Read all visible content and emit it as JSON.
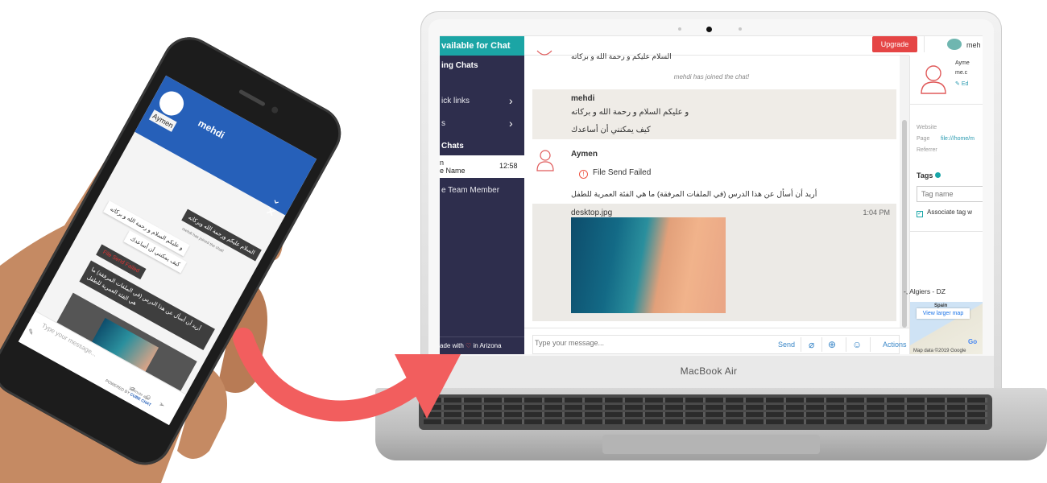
{
  "laptop": {
    "brand": "MacBook Air",
    "app": {
      "sidebar": {
        "status_label": "vailable for Chat",
        "ongoing_label": "ing Chats",
        "quick_links_label": "ick links",
        "item_two_label": "s",
        "chats_heading": "Chats",
        "active_chat": {
          "name": "n",
          "subtitle": "e Name",
          "time": "12:58"
        },
        "team_member_label": "e Team Member",
        "footer_prefix": "ade with",
        "footer_suffix": "in Arizona"
      },
      "conversation": {
        "top_partial_text": "السلام عليكم و رحمة الله و بركاته",
        "system_note": "mehdi has joined the chat!",
        "agent_message": {
          "sender": "mehdi",
          "line1": "و عليكم السلام و رحمة الله و بركاته",
          "line2": "كيف يمكنني أن أساعدك"
        },
        "visitor_message": {
          "sender": "Aymen",
          "failed_text": "File Send Failed",
          "text": "أريد أن أسأل عن هذا الدرس (في الملفات المرفقة) ما هي الفئة العمرية للطفل"
        },
        "attachment": {
          "file_name": "desktop.jpg",
          "time": "1:04 PM"
        }
      },
      "composer": {
        "placeholder": "Type your message...",
        "send_label": "Send",
        "actions_label": "Actions"
      },
      "right_panel": {
        "upgrade_label": "Upgrade",
        "agent_name": "meh",
        "visitor_name": "Ayme",
        "visitor_email": "me.c",
        "edit_label": "Ed",
        "website_label": "Website",
        "page_label": "Page",
        "page_value": "file:///home/m",
        "referrer_label": "Referrer",
        "tags_heading": "Tags",
        "tag_placeholder": "Tag name",
        "associate_label": "Associate tag w",
        "location": "-, Algiers - DZ",
        "map_button": "View larger map",
        "map_label": "Spain",
        "map_credit": "Map data ©2019 Google",
        "map_logo": "Go"
      }
    }
  },
  "phone": {
    "agent_name": "mehdi",
    "visitor_name": "Aymen",
    "msg1": "السلام عليكم ورحمة الله وبركاته",
    "system_note": "mehdi has joined the chat!",
    "msg2": "و عليكم السلام و رحمة الله و بركاته",
    "msg3": "كيف يمكنني أن أساعدك",
    "failed_text": "File Send Failed",
    "msg4": "أريد أن أسأل عن هذا الدرس (في الملفات المرفقة) ما هي الفئة العمرية للطفل",
    "input_placeholder": "Type your message...",
    "time_ago": "1 minute ago",
    "powered_prefix": "POWERED BY",
    "powered_brand": "CUBE CHAT"
  },
  "colors": {
    "sidebar_bg": "#2e2e4d",
    "status_green": "#1ba5a5",
    "upgrade_red": "#e54545",
    "link_blue": "#3a87c8",
    "phone_header_blue": "#2660b9",
    "arrow_red": "#f25e5e"
  }
}
